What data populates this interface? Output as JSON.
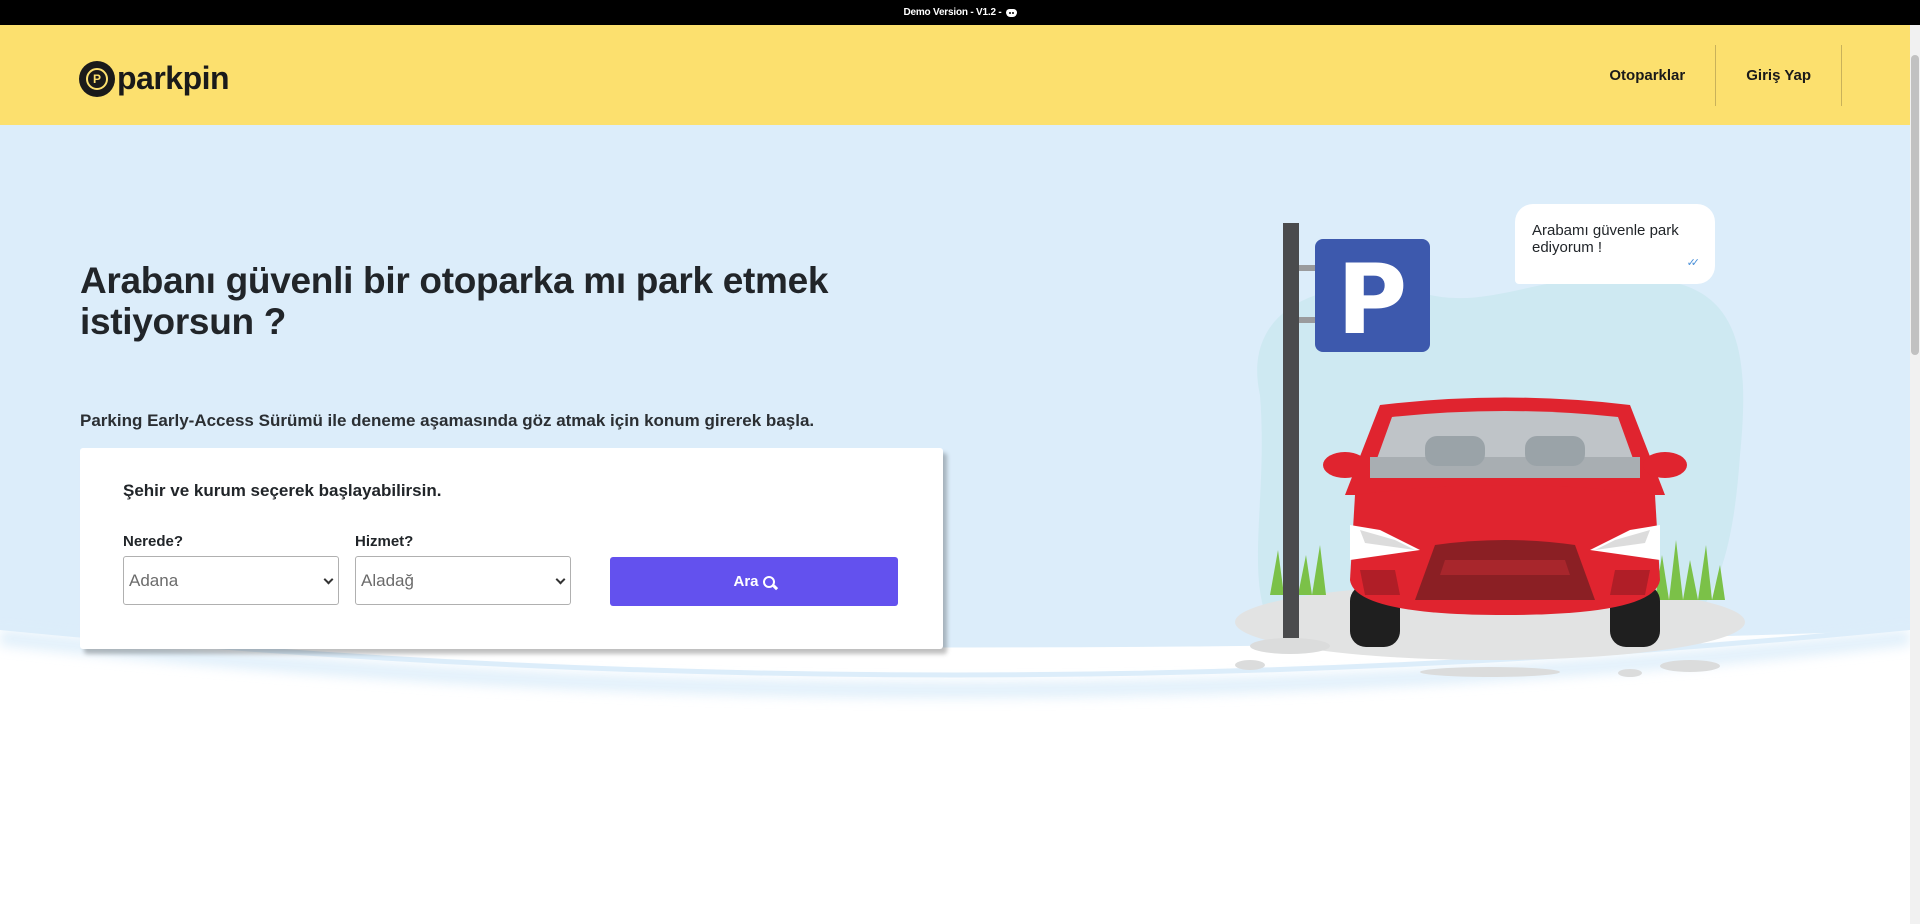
{
  "topbar": {
    "version_text": "Demo Version - V1.2 -",
    "icon": "discord-icon"
  },
  "header": {
    "logo_text": "parkpin",
    "logo_icon": "location-pin-p-icon",
    "nav": [
      {
        "label": "Otoparklar"
      },
      {
        "label": "Giriş Yap"
      }
    ]
  },
  "hero": {
    "headline": "Arabanı güvenli bir otoparka mı park etmek istiyorsun ?",
    "subline": "Parking Early-Access Sürümü ile deneme aşamasında göz atmak için konum girerek başla."
  },
  "search_card": {
    "title": "Şehir ve kurum seçerek başlayabilirsin.",
    "where": {
      "label": "Nerede?",
      "value": "Adana"
    },
    "service": {
      "label": "Hizmet?",
      "value": "Aladağ"
    },
    "button_label": "Ara",
    "button_icon": "search-icon"
  },
  "illustration": {
    "sign_letter": "P",
    "bubble_text": "Arabamı güvenle park ediyorum !",
    "bubble_icon": "double-check-icon"
  },
  "colors": {
    "header_bg": "#fce06e",
    "hero_bg": "#dcedfa",
    "button": "#6351ee",
    "car": "#e0242f",
    "sign": "#3d59ad"
  }
}
